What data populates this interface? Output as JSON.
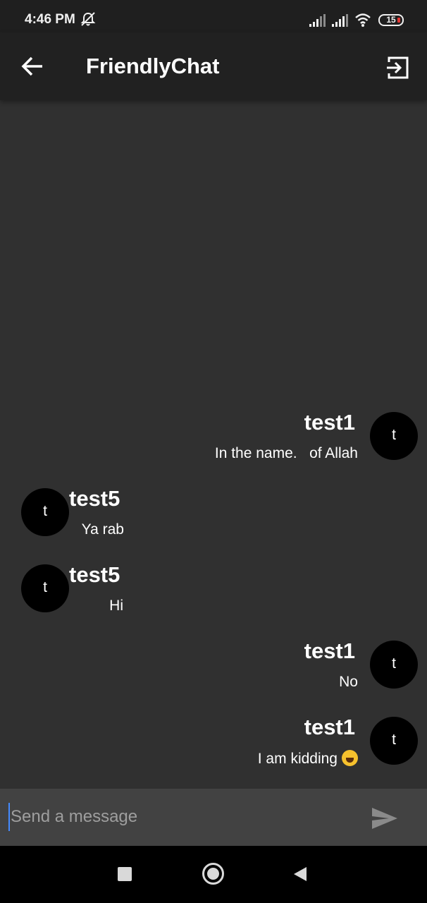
{
  "status_bar": {
    "time": "4:46 PM",
    "battery": "15",
    "icons": [
      "bell-off-icon",
      "signal-icon",
      "signal-icon",
      "wifi-icon",
      "battery-icon"
    ],
    "battery_color": "#e53935"
  },
  "app_bar": {
    "title": "FriendlyChat",
    "back_icon": "arrow-left-icon",
    "logout_icon": "exit-icon",
    "background": "#212121"
  },
  "messages": [
    {
      "side": "right",
      "avatar_letter": "t",
      "sender": "test1",
      "text": "In the name.   of Allah"
    },
    {
      "side": "left",
      "avatar_letter": "t",
      "sender": "test5",
      "text": "Ya rab"
    },
    {
      "side": "left",
      "avatar_letter": "t",
      "sender": "test5",
      "text": "Hi"
    },
    {
      "side": "right",
      "avatar_letter": "t",
      "sender": "test1",
      "text": "No"
    },
    {
      "side": "right",
      "avatar_letter": "t",
      "sender": "test1",
      "text": "I am kidding",
      "emoji": "rolling-on-floor-laughing-emoji"
    }
  ],
  "composer": {
    "placeholder": "Send a message",
    "value": "",
    "send_icon": "send-icon",
    "background": "#424242"
  },
  "nav_bar": {
    "icons": [
      "recents-square-icon",
      "home-circle-icon",
      "back-triangle-icon"
    ]
  },
  "colors": {
    "background": "#303030",
    "avatar": "#000000",
    "cursor": "#448aff"
  }
}
